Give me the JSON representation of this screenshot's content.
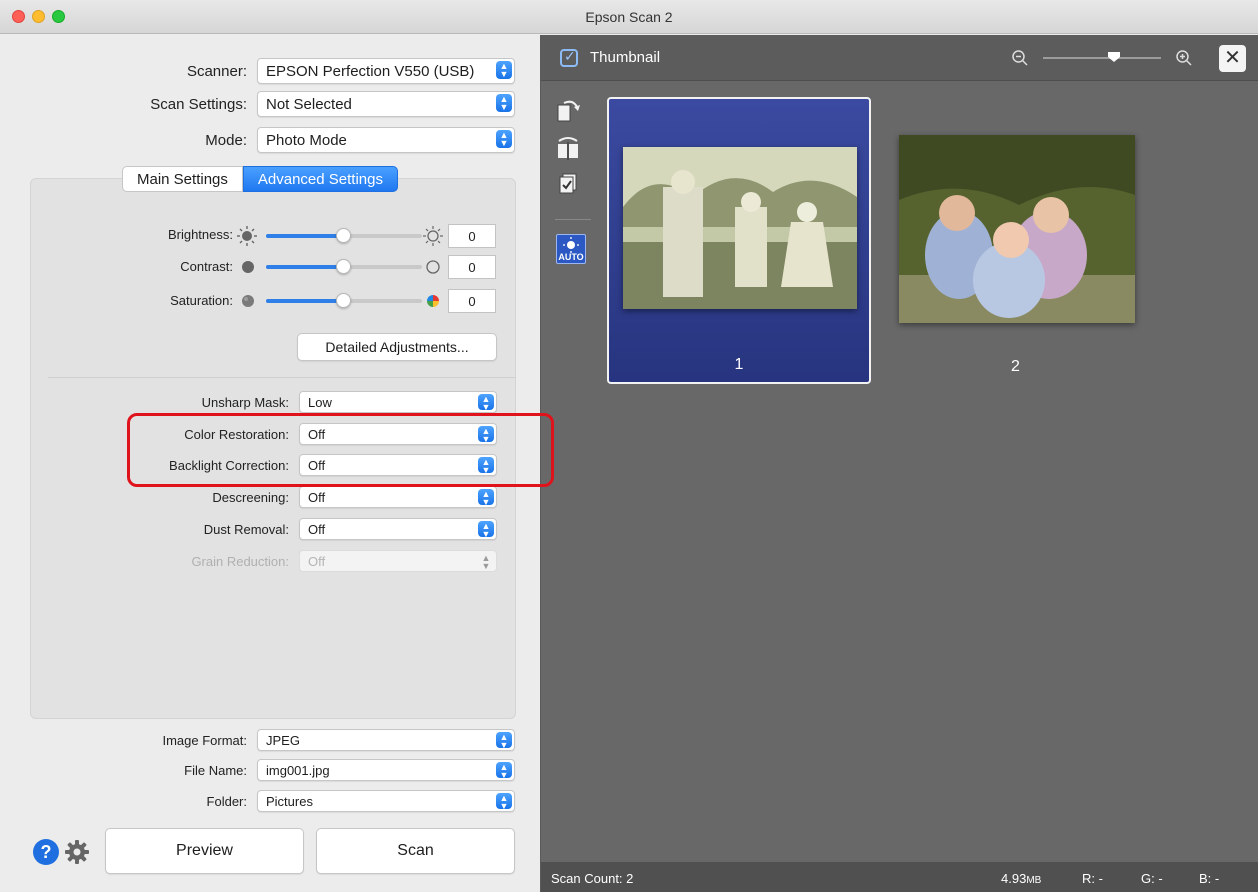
{
  "window": {
    "title": "Epson Scan 2"
  },
  "settings": {
    "scanner": {
      "label": "Scanner:",
      "value": "EPSON Perfection V550 (USB)"
    },
    "scan_settings": {
      "label": "Scan Settings:",
      "value": "Not Selected"
    },
    "mode": {
      "label": "Mode:",
      "value": "Photo Mode"
    }
  },
  "tabs": [
    {
      "label": "Main Settings",
      "active": false
    },
    {
      "label": "Advanced Settings",
      "active": true
    }
  ],
  "adjust": {
    "brightness": {
      "label": "Brightness:",
      "value": "0",
      "level": 0.5
    },
    "contrast": {
      "label": "Contrast:",
      "value": "0",
      "level": 0.5
    },
    "saturation": {
      "label": "Saturation:",
      "value": "0",
      "level": 0.5
    },
    "detailed_button": "Detailed Adjustments..."
  },
  "advanced": {
    "unsharp_mask": {
      "label": "Unsharp Mask:",
      "value": "Low"
    },
    "color_restoration": {
      "label": "Color Restoration:",
      "value": "Off"
    },
    "backlight_correction": {
      "label": "Backlight Correction:",
      "value": "Off"
    },
    "descreening": {
      "label": "Descreening:",
      "value": "Off"
    },
    "dust_removal": {
      "label": "Dust Removal:",
      "value": "Off"
    },
    "grain_reduction": {
      "label": "Grain Reduction:",
      "value": "Off",
      "disabled": true
    }
  },
  "output": {
    "image_format": {
      "label": "Image Format:",
      "value": "JPEG"
    },
    "file_name": {
      "label": "File Name:",
      "value": "img001.jpg"
    },
    "folder": {
      "label": "Folder:",
      "value": "Pictures"
    }
  },
  "actions": {
    "preview": "Preview",
    "scan": "Scan"
  },
  "preview_pane": {
    "thumbnail_label": "Thumbnail",
    "thumbnail_checked": true,
    "zoom_level": 0.6,
    "auto_badge": "AUTO",
    "thumbnails": [
      {
        "number": "1",
        "selected": true
      },
      {
        "number": "2",
        "selected": false
      }
    ]
  },
  "status": {
    "scan_count": "Scan Count: 2",
    "size": "4.93",
    "size_unit": "MB",
    "r": "R:  -",
    "g": "G:  -",
    "b": "B:  -"
  },
  "colors": {
    "accent": "#1f78f0",
    "highlight": "#e0121b",
    "thumb_selected": "#2f3c8f"
  }
}
